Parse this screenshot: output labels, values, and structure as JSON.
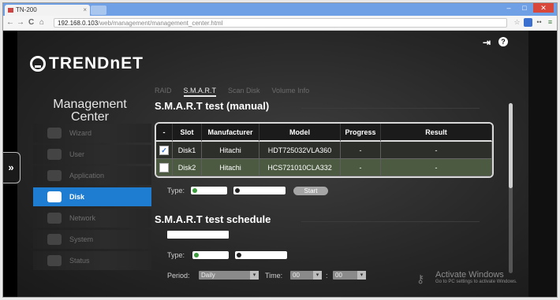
{
  "browser": {
    "tab_title": "TN-200",
    "tab_close": "×",
    "url_host": "192.168.0.103",
    "url_path": "/web/management/management_center.html",
    "nav_back": "←",
    "nav_forward": "→",
    "nav_reload": "C",
    "nav_home": "⌂",
    "window_minimize": "–",
    "window_maximize": "□",
    "window_close": "✕"
  },
  "header": {
    "logo_text": "TRENDnET",
    "logout_icon": "logout-icon",
    "help_icon": "help-icon",
    "help_glyph": "?"
  },
  "sidebar": {
    "title": "Management Center",
    "expand_label": "»",
    "items": [
      {
        "label": "Wizard",
        "icon": "wand-icon",
        "active": false
      },
      {
        "label": "User",
        "icon": "users-icon",
        "active": false
      },
      {
        "label": "Application",
        "icon": "puzzle-icon",
        "active": false
      },
      {
        "label": "Disk",
        "icon": "disk-icon",
        "active": true
      },
      {
        "label": "Network",
        "icon": "network-icon",
        "active": false
      },
      {
        "label": "System",
        "icon": "gears-icon",
        "active": false
      },
      {
        "label": "Status",
        "icon": "bars-icon",
        "active": false
      }
    ]
  },
  "subtabs": [
    {
      "label": "RAID"
    },
    {
      "label": "S.M.A.R.T"
    },
    {
      "label": "Scan Disk"
    },
    {
      "label": "Volume Info"
    }
  ],
  "manual": {
    "title": "S.M.A.R.T test (manual)",
    "columns": [
      "-",
      "Slot",
      "Manufacturer",
      "Model",
      "Progress",
      "Result"
    ],
    "rows": [
      {
        "checked": true,
        "check_glyph": "✓",
        "slot": "Disk1",
        "manufacturer": "Hitachi",
        "model": "HDT725032VLA360",
        "progress": "-",
        "result": "-"
      },
      {
        "checked": false,
        "check_glyph": "",
        "slot": "Disk2",
        "manufacturer": "Hitachi",
        "model": "HCS721010CLA332",
        "progress": "-",
        "result": "-"
      }
    ],
    "type_label": "Type:",
    "start_label": "Start"
  },
  "schedule": {
    "title": "S.M.A.R.T test schedule",
    "type_label": "Type:",
    "period_label": "Period:",
    "period_value": "Daily",
    "time_label": "Time:",
    "time_hour": "00",
    "time_colon": ":",
    "time_minute": "00",
    "dropdown_arrow": "▾"
  },
  "watermark": {
    "title": "Activate Windows",
    "subtitle": "Go to PC settings to activate Windows."
  }
}
